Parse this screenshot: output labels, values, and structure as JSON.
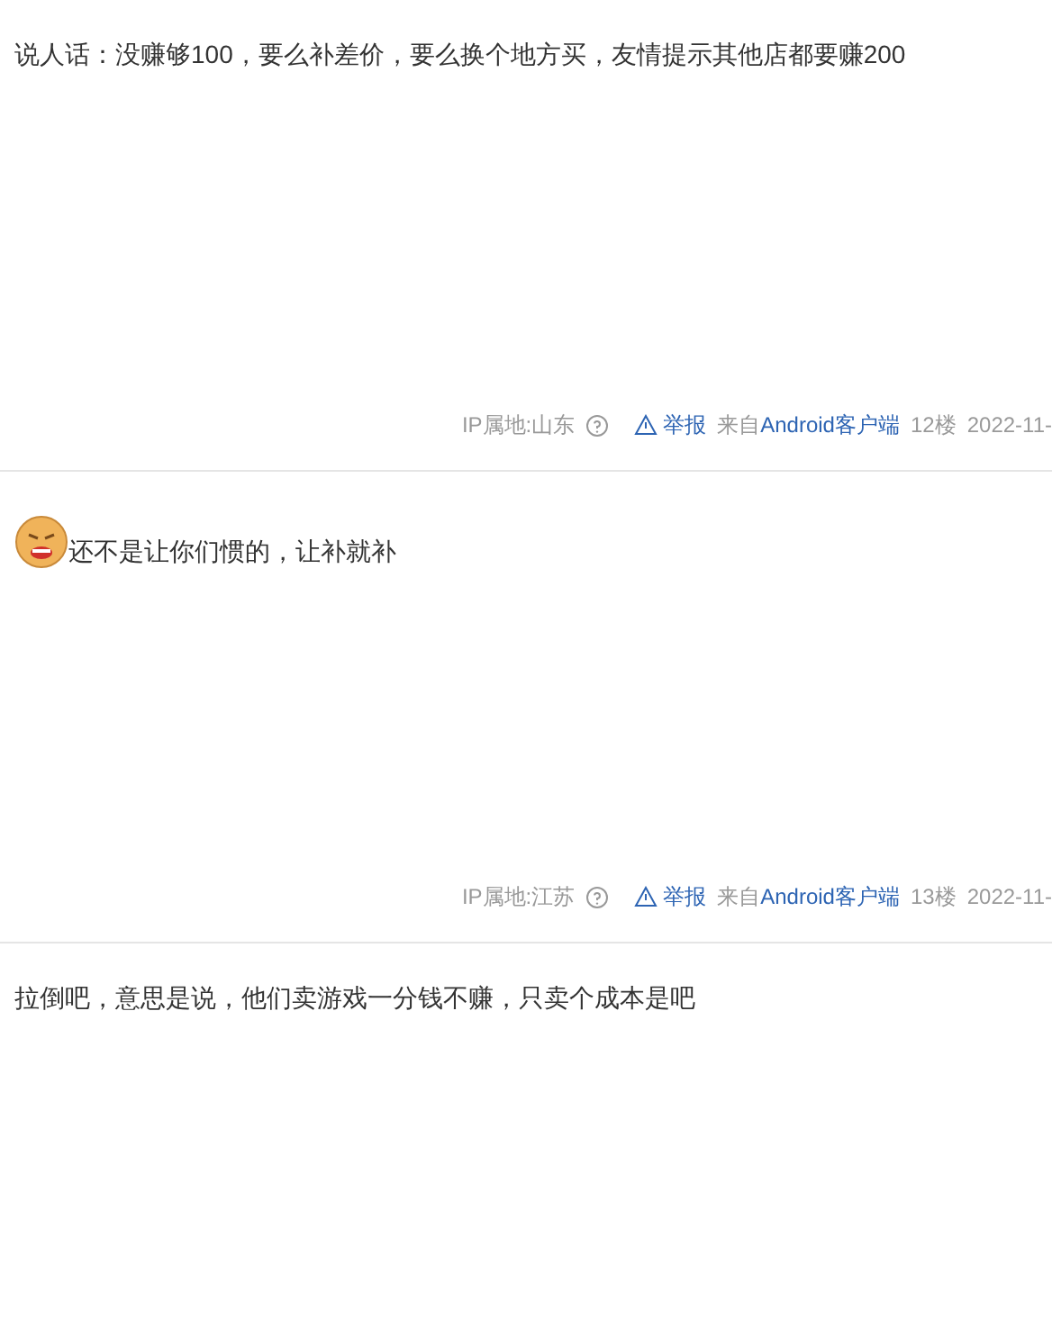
{
  "posts": [
    {
      "content": [
        {
          "kind": "text",
          "text": "说人话：没赚够100，要么补差价，要么换个地方买，友情提示其他店都要赚200"
        }
      ],
      "ip": "IP属地:山东",
      "report": "举报",
      "source_prefix": "来自",
      "source": "Android客户端",
      "floor": "12楼",
      "time": "2022-11-"
    },
    {
      "content": [
        {
          "kind": "emoji"
        },
        {
          "kind": "text",
          "text": "还不是让你们惯的，让补就补"
        }
      ],
      "ip": "IP属地:江苏",
      "report": "举报",
      "source_prefix": "来自",
      "source": "Android客户端",
      "floor": "13楼",
      "time": "2022-11-"
    },
    {
      "content": [
        {
          "kind": "text",
          "text": "拉倒吧，意思是说，他们卖游戏一分钱不赚，只卖个成本是吧"
        }
      ]
    }
  ]
}
